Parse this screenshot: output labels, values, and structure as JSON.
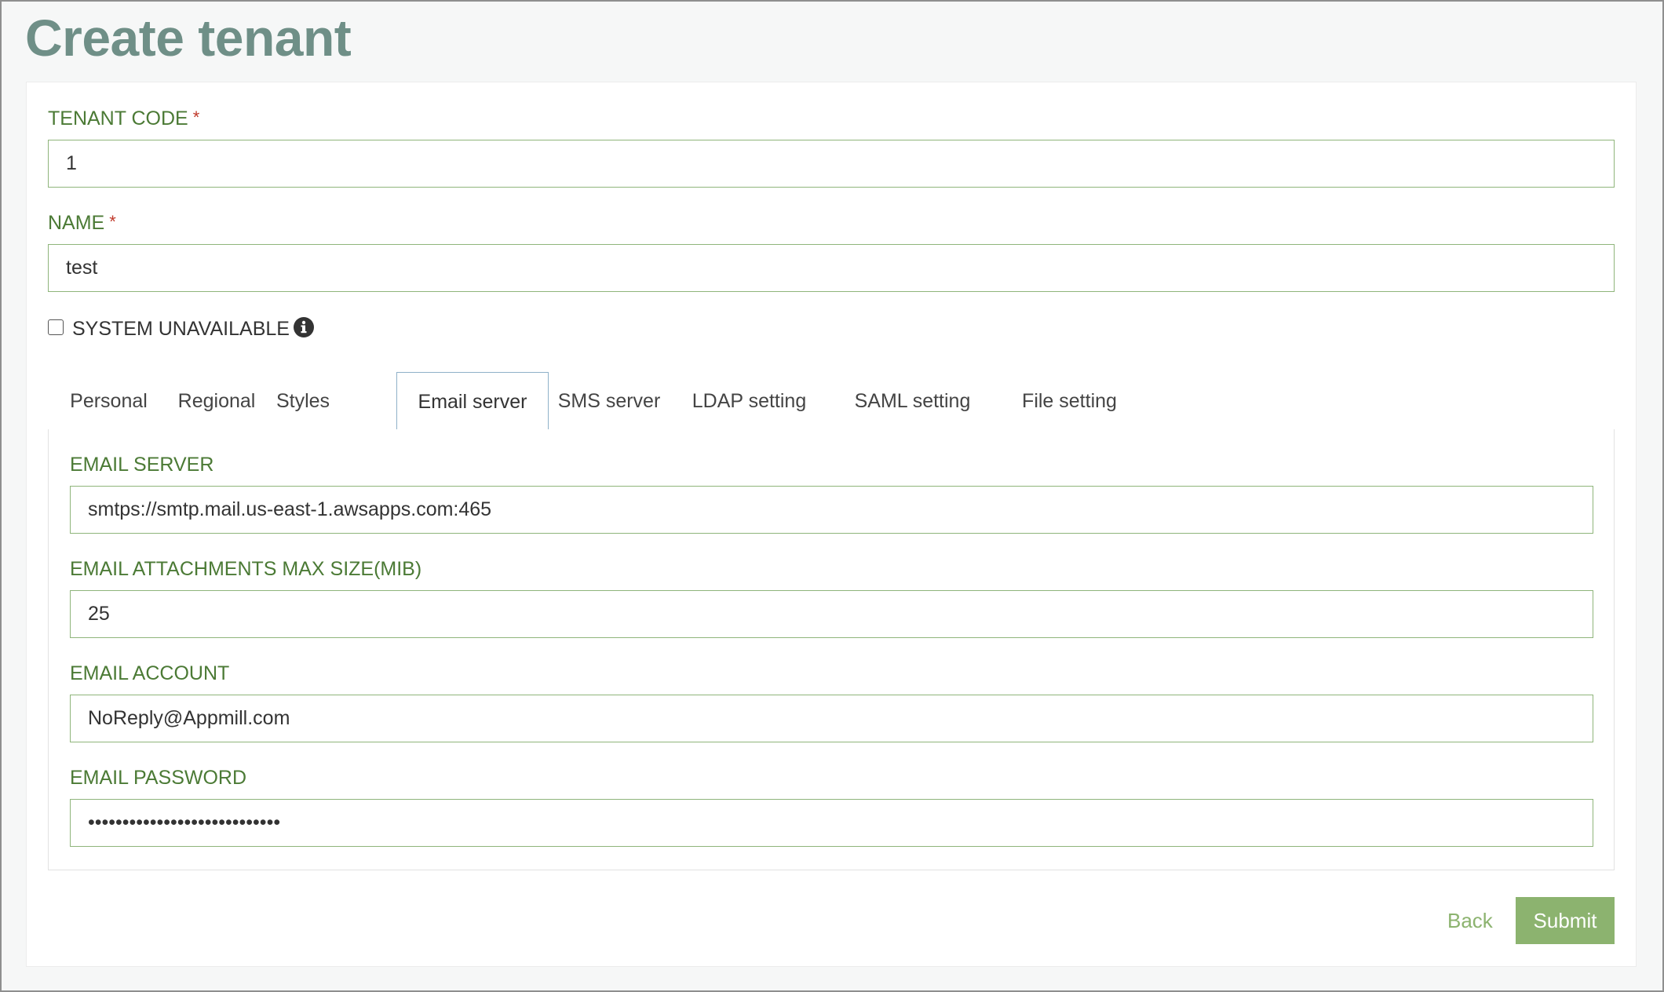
{
  "page": {
    "title": "Create tenant"
  },
  "form": {
    "tenant_code": {
      "label": "TENANT CODE",
      "required_mark": "*",
      "value": "1"
    },
    "name": {
      "label": "NAME",
      "required_mark": "*",
      "value": "test"
    },
    "system_unavailable": {
      "label": "SYSTEM UNAVAILABLE",
      "checked": false,
      "icon": "info-circle-icon"
    }
  },
  "tabs": [
    {
      "label": "Personal",
      "active": false
    },
    {
      "label": "Regional",
      "active": false
    },
    {
      "label": "Styles",
      "active": false
    },
    {
      "label": "Email server",
      "active": true
    },
    {
      "label": "SMS server",
      "active": false
    },
    {
      "label": "LDAP setting",
      "active": false
    },
    {
      "label": "SAML setting",
      "active": false
    },
    {
      "label": "File setting",
      "active": false
    }
  ],
  "email_server": {
    "server": {
      "label": "EMAIL SERVER",
      "value": "smtps://smtp.mail.us-east-1.awsapps.com:465"
    },
    "max_size": {
      "label": "EMAIL ATTACHMENTS MAX SIZE(MIB)",
      "value": "25"
    },
    "account": {
      "label": "EMAIL ACCOUNT",
      "value": "NoReply@Appmill.com"
    },
    "password": {
      "label": "EMAIL PASSWORD",
      "value": "••••••••••••••••••••••••••••"
    }
  },
  "actions": {
    "back_label": "Back",
    "submit_label": "Submit"
  },
  "colors": {
    "title": "#6f8f87",
    "label_green": "#4b7a35",
    "input_border": "#8fb57b",
    "button_green": "#8cb36f",
    "required_red": "#c0392b"
  }
}
